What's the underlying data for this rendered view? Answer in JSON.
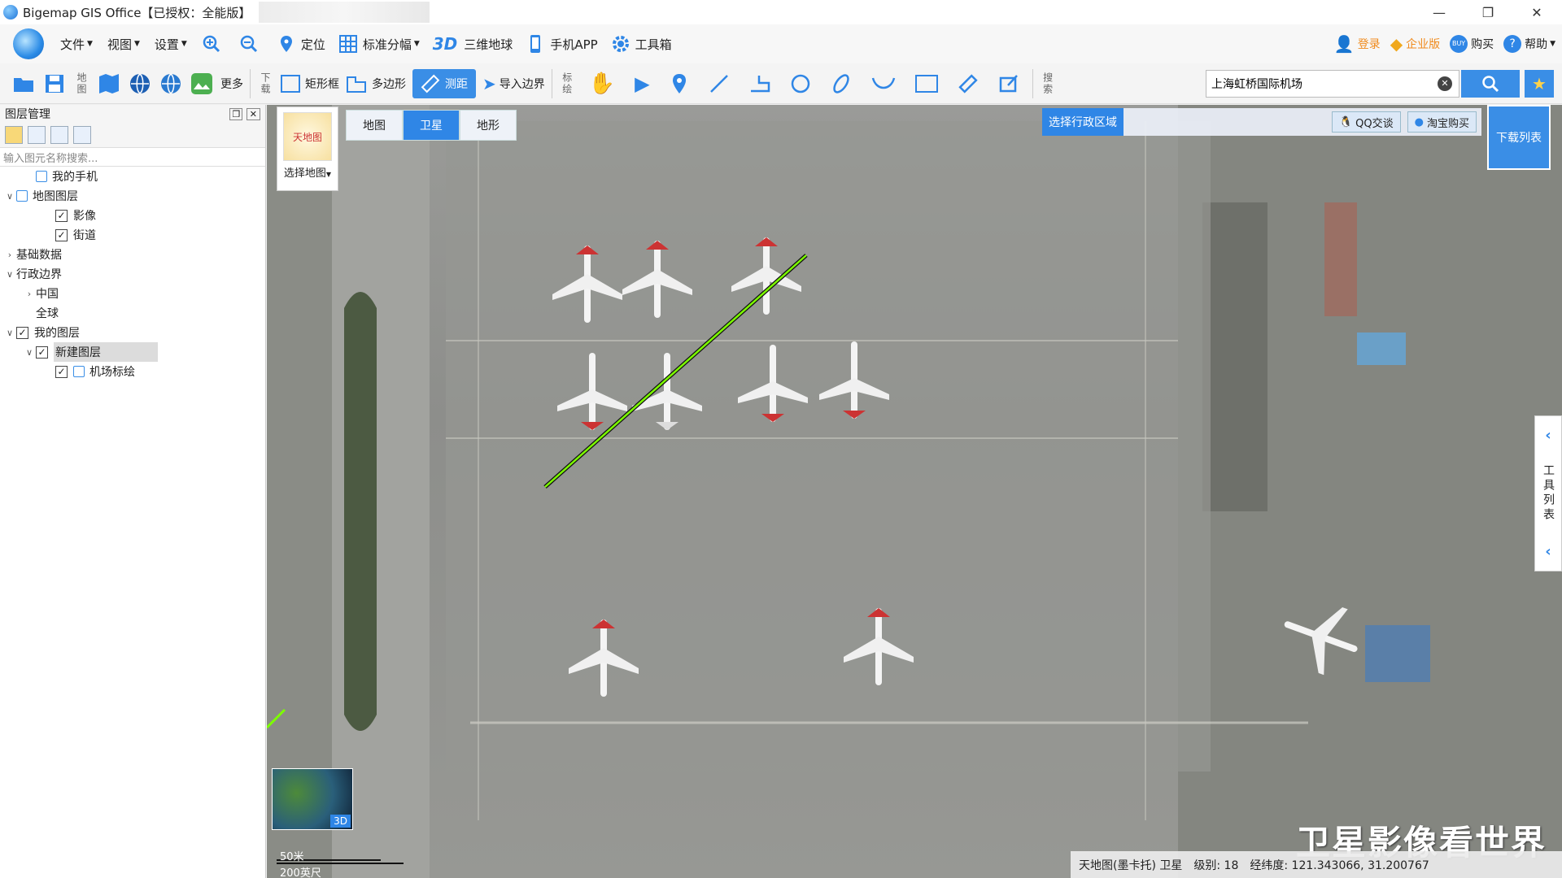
{
  "window": {
    "title": "Bigemap GIS Office【已授权：全能版】"
  },
  "menu": {
    "items": [
      "文件",
      "视图",
      "设置"
    ],
    "tools": [
      "定位",
      "标准分幅",
      "三维地球",
      "手机APP",
      "工具箱"
    ],
    "threeD_badge": "3D",
    "right": [
      "登录",
      "企业版",
      "购买",
      "帮助"
    ]
  },
  "toolbar": {
    "map_label": "地图",
    "more": "更多",
    "download_label": "下载",
    "rect": "矩形框",
    "polygon": "多边形",
    "measure": "测距",
    "import_boundary": "导入边界",
    "draw_label": "标绘",
    "search_label": "搜索",
    "search_value": "上海虹桥国际机场"
  },
  "layer_panel": {
    "title": "图层管理",
    "search_placeholder": "输入图元名称搜索...",
    "tree": [
      {
        "label": "我的手机",
        "level": 1,
        "arrow": "",
        "checkbox": false,
        "icon": "phone-icon"
      },
      {
        "label": "地图图层",
        "level": 0,
        "arrow": "∨",
        "checkbox": false,
        "icon": "layers-icon"
      },
      {
        "label": "影像",
        "level": 2,
        "arrow": "",
        "checkbox": true
      },
      {
        "label": "街道",
        "level": 2,
        "arrow": "",
        "checkbox": true
      },
      {
        "label": "基础数据",
        "level": 0,
        "arrow": "›",
        "checkbox": false
      },
      {
        "label": "行政边界",
        "level": 0,
        "arrow": "∨",
        "checkbox": false
      },
      {
        "label": "中国",
        "level": 1,
        "arrow": "›",
        "checkbox": false
      },
      {
        "label": "全球",
        "level": 1,
        "arrow": "",
        "checkbox": false
      },
      {
        "label": "我的图层",
        "level": 0,
        "arrow": "∨",
        "checkbox": true
      },
      {
        "label": "新建图层",
        "level": 1,
        "arrow": "∨",
        "checkbox": true,
        "selected": true
      },
      {
        "label": "机场标绘",
        "level": 2,
        "arrow": "",
        "checkbox": true,
        "icon": "polygon-icon"
      }
    ]
  },
  "map": {
    "tabs": [
      "地图",
      "卫星",
      "地形"
    ],
    "active_tab": "卫星",
    "select_map": "选择地图",
    "select_region": "选择行政区域",
    "qq": "QQ交谈",
    "taobao": "淘宝购买",
    "download_list": "下载列表",
    "side_tools": "工具列表",
    "globe_badge": "3D",
    "scale_m": "50米",
    "scale_ft": "200英尺",
    "watermark": "卫星影像看世界",
    "status": {
      "source": "天地图(墨卡托) 卫星",
      "level_label": "级别:",
      "level": "18",
      "coord_label": "经纬度:",
      "coord": "121.343066, 31.200767"
    }
  },
  "colors": {
    "accent": "#2f86e6",
    "measure_line": "#7cfc00"
  }
}
